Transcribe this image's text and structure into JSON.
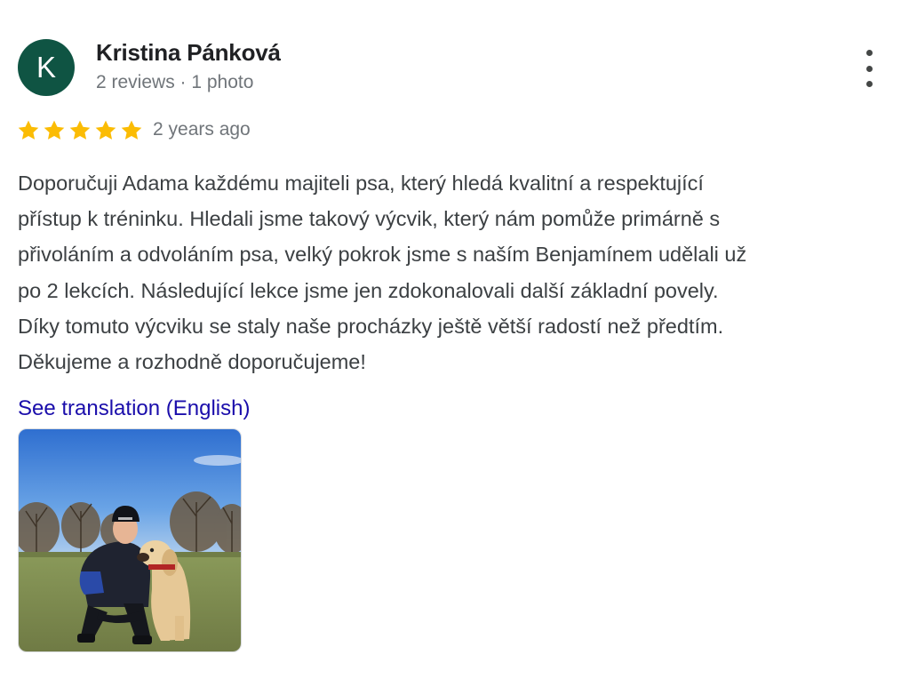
{
  "review": {
    "author_initial": "K",
    "author_name": "Kristina Pánková",
    "author_meta": "2 reviews · 1 photo",
    "rating": 5,
    "rating_max": 5,
    "time_ago": "2 years ago",
    "text_lines": [
      "Doporučuji Adama každému majiteli psa, který hledá kvalitní a respektující",
      "přístup k tréninku. Hledali jsme takový výcvik, který nám pomůže primárně s",
      "přivoláním a odvoláním psa, velký pokrok jsme s naším Benjamínem udělali už",
      "po 2 lekcích. Následující lekce jsme jen zdokonalovali další základní povely.",
      "Díky tomuto výcviku se staly naše procházky ještě větší radostí než předtím.",
      "Děkujeme a rozhodně doporučujeme!"
    ],
    "translate_label": "See translation (English)",
    "more_icon": "three-dots-vertical-icon",
    "star_icon": "star-icon"
  },
  "colors": {
    "avatar_bg": "#0f5443",
    "star": "#fbbc04",
    "link": "#1a0dab",
    "meta_text": "#70757a",
    "body_text": "#3c4043"
  }
}
